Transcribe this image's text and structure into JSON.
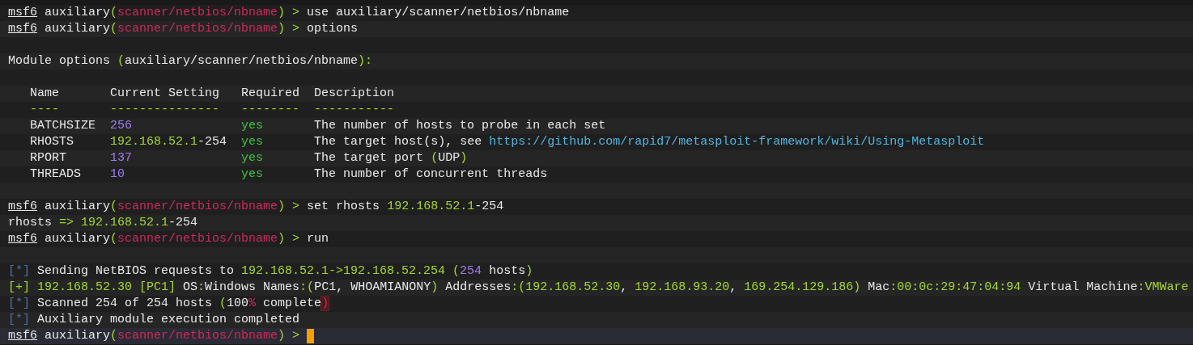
{
  "terminal": {
    "lines": [
      {
        "cursor": false,
        "segments": [
          {
            "kind": "prompt",
            "text": "msf6"
          },
          {
            "kind": "plain",
            "text": " auxiliary"
          },
          {
            "kind": "accent",
            "text": "("
          },
          {
            "kind": "path",
            "text": "scanner/netbios/nbname"
          },
          {
            "kind": "accent",
            "text": ") > "
          },
          {
            "kind": "plain",
            "text": "use auxiliary/scanner/netbios/nbname"
          }
        ]
      },
      {
        "cursor": false,
        "segments": [
          {
            "kind": "prompt",
            "text": "msf6"
          },
          {
            "kind": "plain",
            "text": " auxiliary"
          },
          {
            "kind": "accent",
            "text": "("
          },
          {
            "kind": "path",
            "text": "scanner/netbios/nbname"
          },
          {
            "kind": "accent",
            "text": ") > "
          },
          {
            "kind": "plain",
            "text": "options"
          }
        ]
      },
      {
        "cursor": false
      },
      {
        "cursor": false,
        "segments": [
          {
            "kind": "plain",
            "text": "Module options "
          },
          {
            "kind": "accent",
            "text": "("
          },
          {
            "kind": "plain",
            "text": "auxiliary/scanner/netbios/nbname"
          },
          {
            "kind": "accent",
            "text": "):"
          }
        ]
      },
      {
        "cursor": false
      },
      {
        "cursor": false,
        "segments": [
          {
            "kind": "plain",
            "text": "   Name       Current Setting   Required  Description"
          }
        ]
      },
      {
        "cursor": false,
        "segments": [
          {
            "kind": "accent",
            "text": "   ----       ---------------   --------  -----------"
          }
        ]
      },
      {
        "cursor": false,
        "segments": [
          {
            "kind": "plain",
            "text": "   BATCHSIZE  "
          },
          {
            "kind": "number",
            "text": "256"
          },
          {
            "kind": "ok",
            "text": "               yes"
          },
          {
            "kind": "plain",
            "text": "       The number of hosts to probe in each set"
          }
        ]
      },
      {
        "cursor": false,
        "segments": [
          {
            "kind": "plain",
            "text": "   RHOSTS     "
          },
          {
            "kind": "accent",
            "text": "192.168.52.1"
          },
          {
            "kind": "plain",
            "text": "-254  "
          },
          {
            "kind": "ok",
            "text": "yes"
          },
          {
            "kind": "plain",
            "text": "       The target host(s), see "
          },
          {
            "kind": "link",
            "text": "https://github.com/rapid7/metasploit-framework/wiki/Using-Metasploit"
          }
        ]
      },
      {
        "cursor": false,
        "segments": [
          {
            "kind": "plain",
            "text": "   RPORT      "
          },
          {
            "kind": "number",
            "text": "137"
          },
          {
            "kind": "ok",
            "text": "               yes"
          },
          {
            "kind": "plain",
            "text": "       The target port "
          },
          {
            "kind": "accent",
            "text": "("
          },
          {
            "kind": "plain",
            "text": "UDP"
          },
          {
            "kind": "accent",
            "text": ")"
          }
        ]
      },
      {
        "cursor": false,
        "segments": [
          {
            "kind": "plain",
            "text": "   THREADS    "
          },
          {
            "kind": "number",
            "text": "10"
          },
          {
            "kind": "ok",
            "text": "                yes"
          },
          {
            "kind": "plain",
            "text": "       The number of concurrent threads"
          }
        ]
      },
      {
        "cursor": false
      },
      {
        "cursor": false,
        "segments": [
          {
            "kind": "prompt",
            "text": "msf6"
          },
          {
            "kind": "plain",
            "text": " auxiliary"
          },
          {
            "kind": "accent",
            "text": "("
          },
          {
            "kind": "path",
            "text": "scanner/netbios/nbname"
          },
          {
            "kind": "accent",
            "text": ") > "
          },
          {
            "kind": "plain",
            "text": "set rhosts "
          },
          {
            "kind": "accent",
            "text": "192.168.52.1"
          },
          {
            "kind": "plain",
            "text": "-254"
          }
        ]
      },
      {
        "cursor": false,
        "segments": [
          {
            "kind": "plain",
            "text": "rhosts "
          },
          {
            "kind": "accent",
            "text": "=> 192.168.52.1"
          },
          {
            "kind": "plain",
            "text": "-254"
          }
        ]
      },
      {
        "cursor": false,
        "segments": [
          {
            "kind": "prompt",
            "text": "msf6"
          },
          {
            "kind": "plain",
            "text": " auxiliary"
          },
          {
            "kind": "accent",
            "text": "("
          },
          {
            "kind": "path",
            "text": "scanner/netbios/nbname"
          },
          {
            "kind": "accent",
            "text": ") > "
          },
          {
            "kind": "plain",
            "text": "run"
          }
        ]
      },
      {
        "cursor": false
      },
      {
        "cursor": false,
        "segments": [
          {
            "kind": "mark",
            "text": "[*]"
          },
          {
            "kind": "plain",
            "text": " Sending NetBIOS requests to "
          },
          {
            "kind": "accent",
            "text": "192.168.52.1->192.168.52.254 ("
          },
          {
            "kind": "number",
            "text": "254"
          },
          {
            "kind": "plain",
            "text": " hosts"
          },
          {
            "kind": "accent",
            "text": ")"
          }
        ]
      },
      {
        "cursor": false,
        "segments": [
          {
            "kind": "accent",
            "text": "[+] 192.168.52.30 [PC1]"
          },
          {
            "kind": "plain",
            "text": " OS"
          },
          {
            "kind": "accent",
            "text": ":"
          },
          {
            "kind": "plain",
            "text": "Windows Names"
          },
          {
            "kind": "accent",
            "text": ":("
          },
          {
            "kind": "plain",
            "text": "PC1, WHOAMIANONY"
          },
          {
            "kind": "accent",
            "text": ")"
          },
          {
            "kind": "plain",
            "text": " Addresses"
          },
          {
            "kind": "accent",
            "text": ":(192.168.52.30"
          },
          {
            "kind": "plain",
            "text": ", "
          },
          {
            "kind": "accent",
            "text": "192.168.93.20"
          },
          {
            "kind": "plain",
            "text": ", "
          },
          {
            "kind": "accent",
            "text": "169.254.129.186)"
          },
          {
            "kind": "plain",
            "text": " Mac"
          },
          {
            "kind": "accent",
            "text": ":00:0c:29:47:04:94"
          },
          {
            "kind": "plain",
            "text": " Virtual Machine"
          },
          {
            "kind": "accent",
            "text": ":VMWare"
          }
        ]
      },
      {
        "cursor": false,
        "segments": [
          {
            "kind": "mark",
            "text": "[*]"
          },
          {
            "kind": "plain",
            "text": " Scanned 254 of 254 hosts "
          },
          {
            "kind": "accent",
            "text": "("
          },
          {
            "kind": "plain",
            "text": "100"
          },
          {
            "kind": "alert",
            "text": "%"
          },
          {
            "kind": "plain",
            "text": " complete"
          },
          {
            "kind": "flagged",
            "text": ")"
          }
        ]
      },
      {
        "cursor": false,
        "segments": [
          {
            "kind": "mark",
            "text": "[*]"
          },
          {
            "kind": "plain",
            "text": " Auxiliary module execution completed"
          }
        ]
      },
      {
        "cursor": true,
        "segments": [
          {
            "kind": "prompt",
            "text": "msf6"
          },
          {
            "kind": "plain",
            "text": " auxiliary"
          },
          {
            "kind": "accent",
            "text": "("
          },
          {
            "kind": "path",
            "text": "scanner/netbios/nbname"
          },
          {
            "kind": "accent",
            "text": ") > "
          }
        ]
      }
    ]
  }
}
